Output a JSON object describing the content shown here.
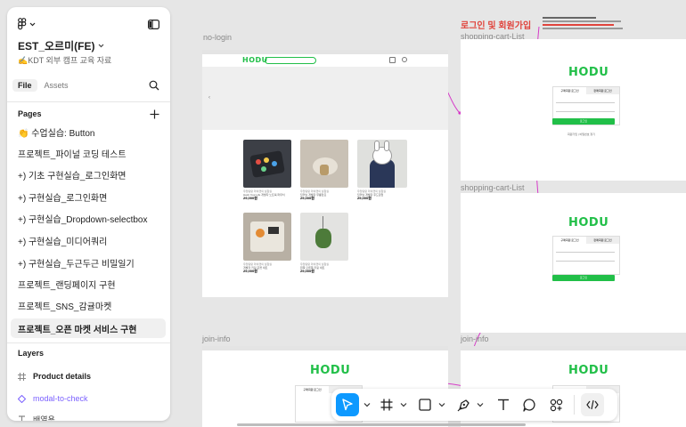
{
  "file": {
    "name": "EST_오르미(FE)",
    "subtitle": "✍️KDT 외부 캠프 교육 자료"
  },
  "tabs": {
    "file": "File",
    "assets": "Assets"
  },
  "pages": {
    "title": "Pages",
    "items": [
      {
        "label": "👏 수업실습: Button"
      },
      {
        "label": "프로젝트_파이널 코딩 테스트"
      },
      {
        "label": "+) 기초 구현실습_로그인화면"
      },
      {
        "label": "+) 구현실습_로그인화면"
      },
      {
        "label": "+) 구현실습_Dropdown-selectbox"
      },
      {
        "label": "+) 구현실습_미디어쿼리"
      },
      {
        "label": "+) 구현실습_두근두근 비밀일기"
      },
      {
        "label": "프로젝트_랜딩페이지 구현"
      },
      {
        "label": "프로젝트_SNS_감귤마켓"
      },
      {
        "label": "프로젝트_오픈 마켓 서비스 구현"
      }
    ]
  },
  "layers": {
    "title": "Layers",
    "items": [
      {
        "label": "Product details"
      },
      {
        "label": "modal-to-check"
      },
      {
        "label": "배열용"
      }
    ]
  },
  "canvas": {
    "frame_labels": {
      "no_login": "no-login",
      "cart1": "shopping-cart-List",
      "cart2": "shopping-cart-List",
      "join1": "join-info",
      "join2": "join-info"
    },
    "section_title": "로그인 및 회원가입",
    "logo": "HODU",
    "tab_buyer": "구매회원 로그인",
    "tab_seller": "판매회원 로그인",
    "login_btn": "로그인",
    "join_links": "회원가입 | 비밀번호 찾기",
    "products": [
      {
        "seller": "우당탕탕 라이캣의 실험실",
        "name": "Hack Your Life 개발자 노트북 파우치",
        "price": "29,000원"
      },
      {
        "seller": "우당탕탕 라이캣의 실험실",
        "name": "딥러닝 개발자 무릎담요",
        "price": "29,000원"
      },
      {
        "seller": "우당탕탕 라이캣의 실험실",
        "name": "딥러닝 개발자 후드집업",
        "price": "29,000원"
      },
      {
        "seller": "우당탕탕 라이캣의 실험실",
        "name": "개발자 키링 포켓 세트",
        "price": "29,000원"
      },
      {
        "seller": "우당탕탕 라이캣의 실험실",
        "name": "왼쪽 오른쪽 키링 세트",
        "price": "29,000원"
      }
    ]
  },
  "colors": {
    "accent": "#0d99ff",
    "brand_green": "#21bf48",
    "connector": "#d63ac8",
    "layer_component": "#7b61ff",
    "section_title": "#e0443c"
  },
  "toolbar": [
    {
      "icon": "move-tool-icon",
      "selected": true
    },
    {
      "icon": "frame-tool-icon"
    },
    {
      "icon": "rectangle-tool-icon"
    },
    {
      "icon": "pen-tool-icon"
    },
    {
      "icon": "text-tool-icon"
    },
    {
      "icon": "comment-tool-icon"
    },
    {
      "icon": "components-tool-icon"
    },
    {
      "icon": "dev-mode-icon"
    }
  ]
}
